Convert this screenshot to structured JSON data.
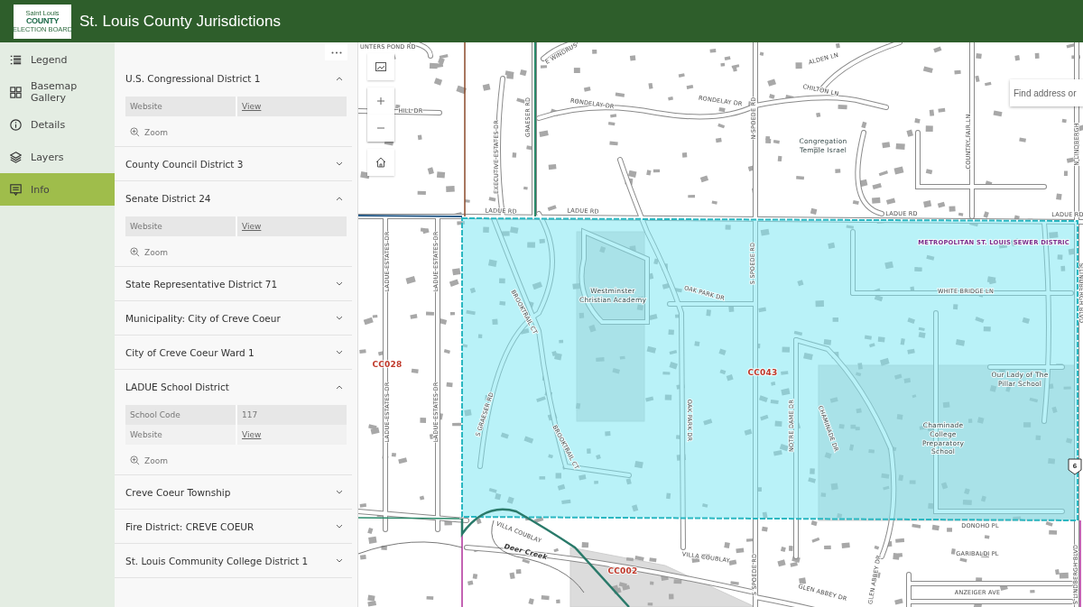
{
  "header": {
    "logo": {
      "top": "Saint Louis",
      "main": "COUNTY",
      "bottom": "ELECTION BOARD"
    },
    "title": "St. Louis County Jurisdictions"
  },
  "nav": [
    {
      "label": "Legend",
      "selected": false
    },
    {
      "label": "Basemap Gallery",
      "selected": false
    },
    {
      "label": "Details",
      "selected": false
    },
    {
      "label": "Layers",
      "selected": false
    },
    {
      "label": "Info",
      "selected": true
    }
  ],
  "panel": {
    "items": [
      {
        "title": "U.S. Congressional District 1",
        "expanded": true,
        "rows": [
          {
            "label": "Website",
            "value": "View",
            "kind": "link"
          }
        ],
        "zoom": "Zoom"
      },
      {
        "title": "County Council District 3",
        "expanded": false
      },
      {
        "title": "Senate District 24",
        "expanded": true,
        "rows": [
          {
            "label": "Website",
            "value": "View",
            "kind": "link"
          }
        ],
        "zoom": "Zoom"
      },
      {
        "title": "State Representative District 71",
        "expanded": false
      },
      {
        "title": "Municipality: City of Creve Coeur",
        "expanded": false
      },
      {
        "title": "City of Creve Coeur Ward 1",
        "expanded": false
      },
      {
        "title": "LADUE School District",
        "expanded": true,
        "rows": [
          {
            "label": "School Code",
            "value": "117",
            "kind": "text"
          },
          {
            "label": "Website",
            "value": "View",
            "kind": "link"
          }
        ],
        "zoom": "Zoom"
      },
      {
        "title": "Creve Coeur Township",
        "expanded": false
      },
      {
        "title": "Fire District: CREVE COEUR",
        "expanded": false
      },
      {
        "title": "St. Louis Community College District 1",
        "expanded": false
      }
    ]
  },
  "map": {
    "search": {
      "placeholder": "Find address or"
    },
    "labels": [
      {
        "kind": "street",
        "text": "UNTERS POND RD"
      },
      {
        "kind": "street",
        "text": "HILL DR"
      },
      {
        "kind": "street",
        "text": "E WINDRUS"
      },
      {
        "kind": "street",
        "text": "RONDELAY DR"
      },
      {
        "kind": "street",
        "text": "RONDELAY DR"
      },
      {
        "kind": "street",
        "text": "CHILTON LN"
      },
      {
        "kind": "street",
        "text": "ALDEN LN"
      },
      {
        "kind": "street",
        "text": "EXECUTIVE ESTATES DR"
      },
      {
        "kind": "street",
        "text": "GRAESER RD"
      },
      {
        "kind": "street",
        "text": "N SPOEDE RD"
      },
      {
        "kind": "street",
        "text": "COUNTRY FAIR LN"
      },
      {
        "kind": "street",
        "text": "N LINDBERGH"
      },
      {
        "kind": "place",
        "lines": [
          "Congregation",
          "Temple Israel"
        ]
      },
      {
        "kind": "street",
        "text": "LADUE RD"
      },
      {
        "kind": "street",
        "text": "LADUE RD"
      },
      {
        "kind": "street",
        "text": "LADUE RD"
      },
      {
        "kind": "street",
        "text": "LADUE RD"
      },
      {
        "kind": "district",
        "text": "METROPOLITAN ST. LOUIS SEWER DISTRIC"
      },
      {
        "kind": "street",
        "text": "LADUE ESTATES DR"
      },
      {
        "kind": "street",
        "text": "LADUE ESTATES DR"
      },
      {
        "kind": "street",
        "text": "LADUE ESTATES DR"
      },
      {
        "kind": "street",
        "text": "LADUE ESTATES DR"
      },
      {
        "kind": "street",
        "text": "BROOKTRAIL CT"
      },
      {
        "kind": "street",
        "text": "BROOKTRAIL CT"
      },
      {
        "kind": "street",
        "text": "S GRAESER RD"
      },
      {
        "kind": "place",
        "lines": [
          "Westminster",
          "Christian Academy"
        ]
      },
      {
        "kind": "street",
        "text": "OAK PARK DR"
      },
      {
        "kind": "street",
        "text": "OAK PARK DR"
      },
      {
        "kind": "street",
        "text": "S SPOEDE RD"
      },
      {
        "kind": "street",
        "text": "WHITE BRIDGE LN"
      },
      {
        "kind": "street",
        "text": "NOTRE DAME DR"
      },
      {
        "kind": "street",
        "text": "CHAMINADE DR"
      },
      {
        "kind": "street",
        "text": "S LINDBERGH BLVD"
      },
      {
        "kind": "place",
        "lines": [
          "Our Lady of The",
          "Pillar School"
        ]
      },
      {
        "kind": "place",
        "lines": [
          "Chaminade",
          "College",
          "Preparatory",
          "School"
        ]
      },
      {
        "kind": "precinct",
        "text": "CC028"
      },
      {
        "kind": "precinct",
        "text": "CC043"
      },
      {
        "kind": "shield",
        "text": "6"
      },
      {
        "kind": "street",
        "text": "DONOHO PL"
      },
      {
        "kind": "street",
        "text": "VILLA COUBLAY"
      },
      {
        "kind": "street",
        "text": "VILLA COUBLAY"
      },
      {
        "kind": "water",
        "text": "Deer Creek"
      },
      {
        "kind": "precinct",
        "text": "CC002"
      },
      {
        "kind": "street",
        "text": "S SPOEDE RD"
      },
      {
        "kind": "street",
        "text": "GLEN ABBEY DR"
      },
      {
        "kind": "street",
        "text": "GLEN ABBEY DR"
      },
      {
        "kind": "street",
        "text": "GARIBALDI PL"
      },
      {
        "kind": "street",
        "text": "ANZEIGER AVE"
      },
      {
        "kind": "street",
        "text": "S LINDBERGH BLVD"
      }
    ]
  }
}
